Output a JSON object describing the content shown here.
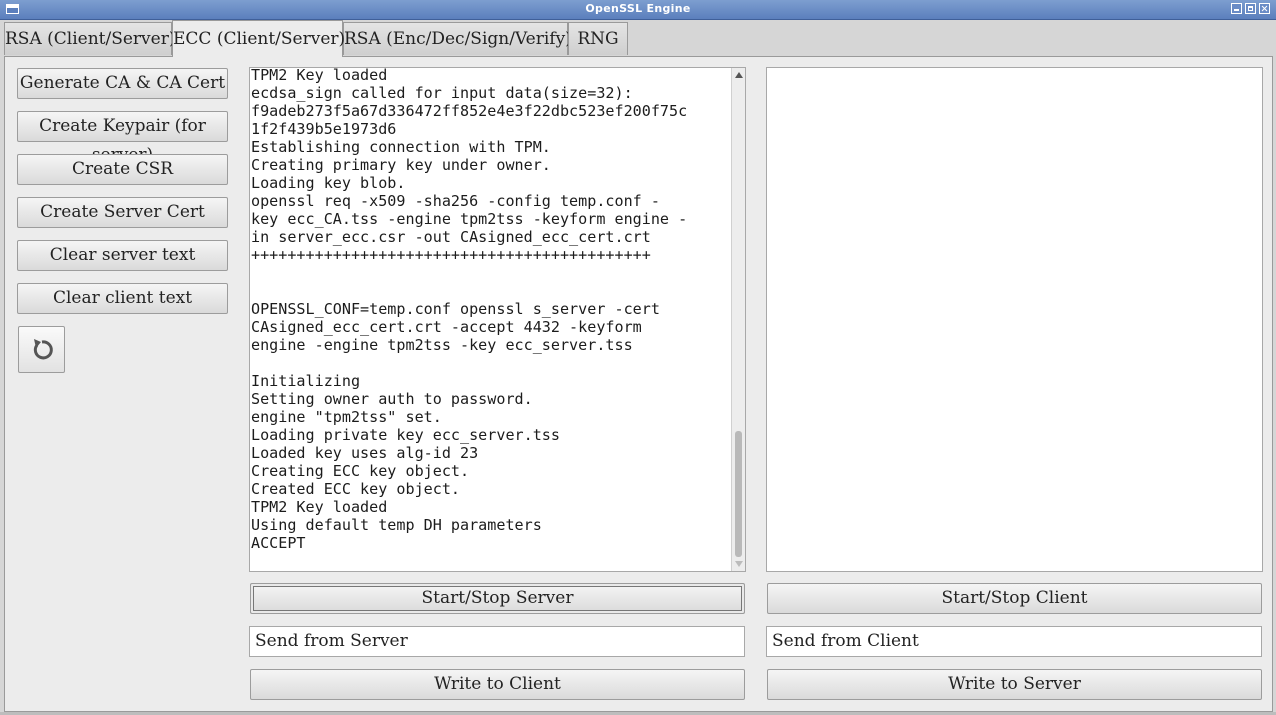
{
  "window": {
    "title": "OpenSSL Engine"
  },
  "tabs": [
    {
      "label": "RSA (Client/Server)"
    },
    {
      "label": "ECC (Client/Server)"
    },
    {
      "label": "RSA (Enc/Dec/Sign/Verify)"
    },
    {
      "label": "RNG"
    }
  ],
  "active_tab": "ECC (Client/Server)",
  "actions": {
    "generate_ca": "Generate CA & CA Cert",
    "create_keypair": "Create Keypair (for server)",
    "create_csr": "Create CSR",
    "create_server_cert": "Create Server Cert",
    "clear_server": "Clear server text",
    "clear_client": "Clear client text",
    "undo_icon": "undo-icon"
  },
  "server": {
    "log": "TPM2 Key loaded\necdsa_sign called for input data(size=32):\nf9adeb273f5a67d336472ff852e4e3f22dbc523ef200f75c\n1f2f439b5e1973d6\nEstablishing connection with TPM.\nCreating primary key under owner.\nLoading key blob.\nopenssl req -x509 -sha256 -config temp.conf -\nkey ecc_CA.tss -engine tpm2tss -keyform engine -\nin server_ecc.csr -out CAsigned_ecc_cert.crt\n++++++++++++++++++++++++++++++++++++++++++++\n\n\nOPENSSL_CONF=temp.conf openssl s_server -cert\nCAsigned_ecc_cert.crt -accept 4432 -keyform\nengine -engine tpm2tss -key ecc_server.tss\n\nInitializing\nSetting owner auth to password.\nengine \"tpm2tss\" set.\nLoading private key ecc_server.tss\nLoaded key uses alg-id 23\nCreating ECC key object.\nCreated ECC key object.\nTPM2 Key loaded\nUsing default temp DH parameters\nACCEPT",
    "start_stop": "Start/Stop Server",
    "send_input": "Send from Server",
    "write": "Write to Client"
  },
  "client": {
    "log": "",
    "start_stop": "Start/Stop Client",
    "send_input": "Send from Client",
    "write": "Write to Server"
  }
}
